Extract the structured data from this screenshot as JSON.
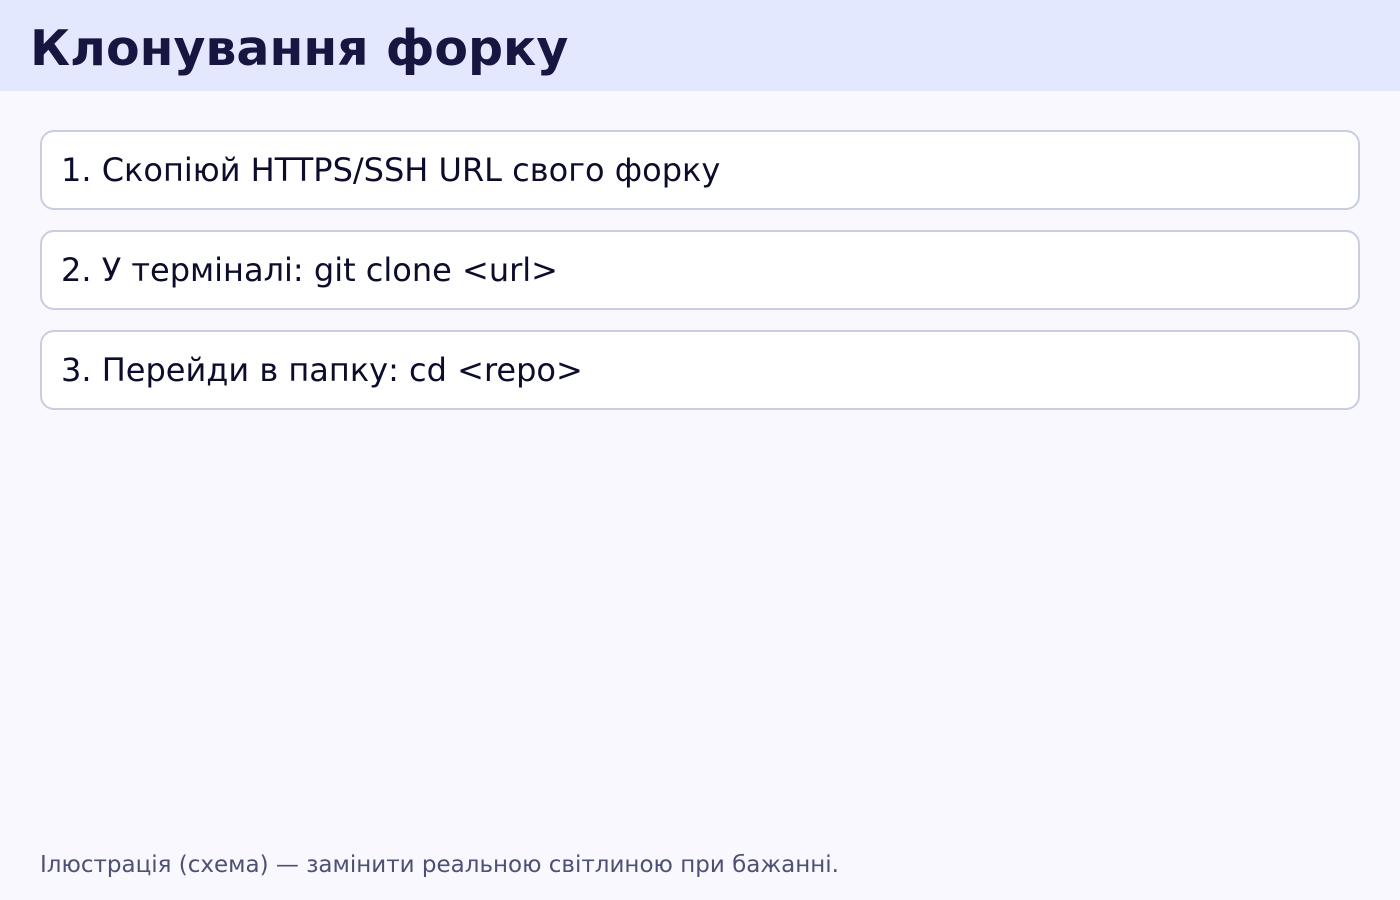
{
  "header": {
    "title": "Клонування форку"
  },
  "steps": [
    {
      "text": "1. Скопіюй HTTPS/SSH URL свого форку"
    },
    {
      "text": "2. У терміналі: git clone <url>"
    },
    {
      "text": "3. Перейди в папку: cd <repo>"
    }
  ],
  "footer": {
    "note": "Ілюстрація (схема) — замінити реальною світлиною при бажанні."
  },
  "colors": {
    "header_background": "#e4e8fe",
    "page_background": "#f8f8fe",
    "title": "#161640",
    "card_border": "#c8cde0",
    "note": "#4e5074"
  }
}
